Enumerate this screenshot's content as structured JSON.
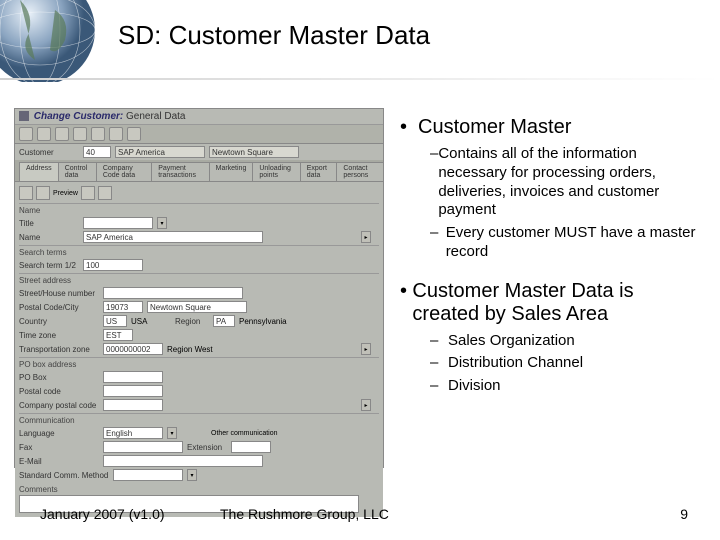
{
  "title": "SD: Customer Master Data",
  "sap": {
    "window_title_prefix": "Change Customer:",
    "window_title_rest": "General Data",
    "toolbar_buttons": [
      "t1",
      "t2",
      "t3",
      "t4",
      "t5",
      "t6",
      "t7"
    ],
    "customer_row": {
      "label": "Customer",
      "id": "40",
      "name": "SAP America",
      "loc": "Newtown Square"
    },
    "tabs": [
      "Address",
      "Control data",
      "Company Code data",
      "Payment transactions",
      "Marketing",
      "Unloading points",
      "Export data",
      "Contact persons"
    ],
    "name_section": {
      "hdr": "Name",
      "title_label": "Title",
      "name_label": "Name",
      "name_value": "SAP America"
    },
    "search_section": {
      "hdr": "Search terms",
      "label": "Search term 1/2",
      "value": "100"
    },
    "street_section": {
      "hdr": "Street address",
      "street_label": "Street/House number",
      "postal_label": "Postal Code/City",
      "postal_value": "19073",
      "city_value": "Newtown Square",
      "country_label": "Country",
      "country_code": "US",
      "country_name": "USA",
      "region_label": "Region",
      "region_code": "PA",
      "region_name": "Pennsylvania",
      "tz_label": "Time zone",
      "tz_value": "EST",
      "transzone_label": "Transportation zone",
      "transzone_value": "0000000002",
      "transzone_name": "Region West"
    },
    "pobox_section": {
      "hdr": "PO box address",
      "pobox_label": "PO Box",
      "postal_label": "Postal code",
      "company_postal_label": "Company postal code"
    },
    "comm_section": {
      "hdr": "Communication",
      "lang_label": "Language",
      "lang_value": "English",
      "other_label": "Other communication",
      "fax_label": "Fax",
      "ext_label": "Extension",
      "email_label": "E-Mail",
      "std_label": "Standard Comm. Method"
    },
    "comments_label": "Comments"
  },
  "bullets": {
    "b1a": "Customer Master",
    "b1a_sub": [
      "Contains all of the information necessary for processing orders, deliveries, invoices and customer payment",
      "Every customer MUST have a master record"
    ],
    "b1b": "Customer Master Data is created by Sales Area",
    "b1b_sub": [
      "Sales Organization",
      "Distribution Channel",
      "Division"
    ]
  },
  "footer": {
    "date": "January 2007 (v1.0)",
    "org": "The Rushmore Group, LLC",
    "page": "9"
  }
}
